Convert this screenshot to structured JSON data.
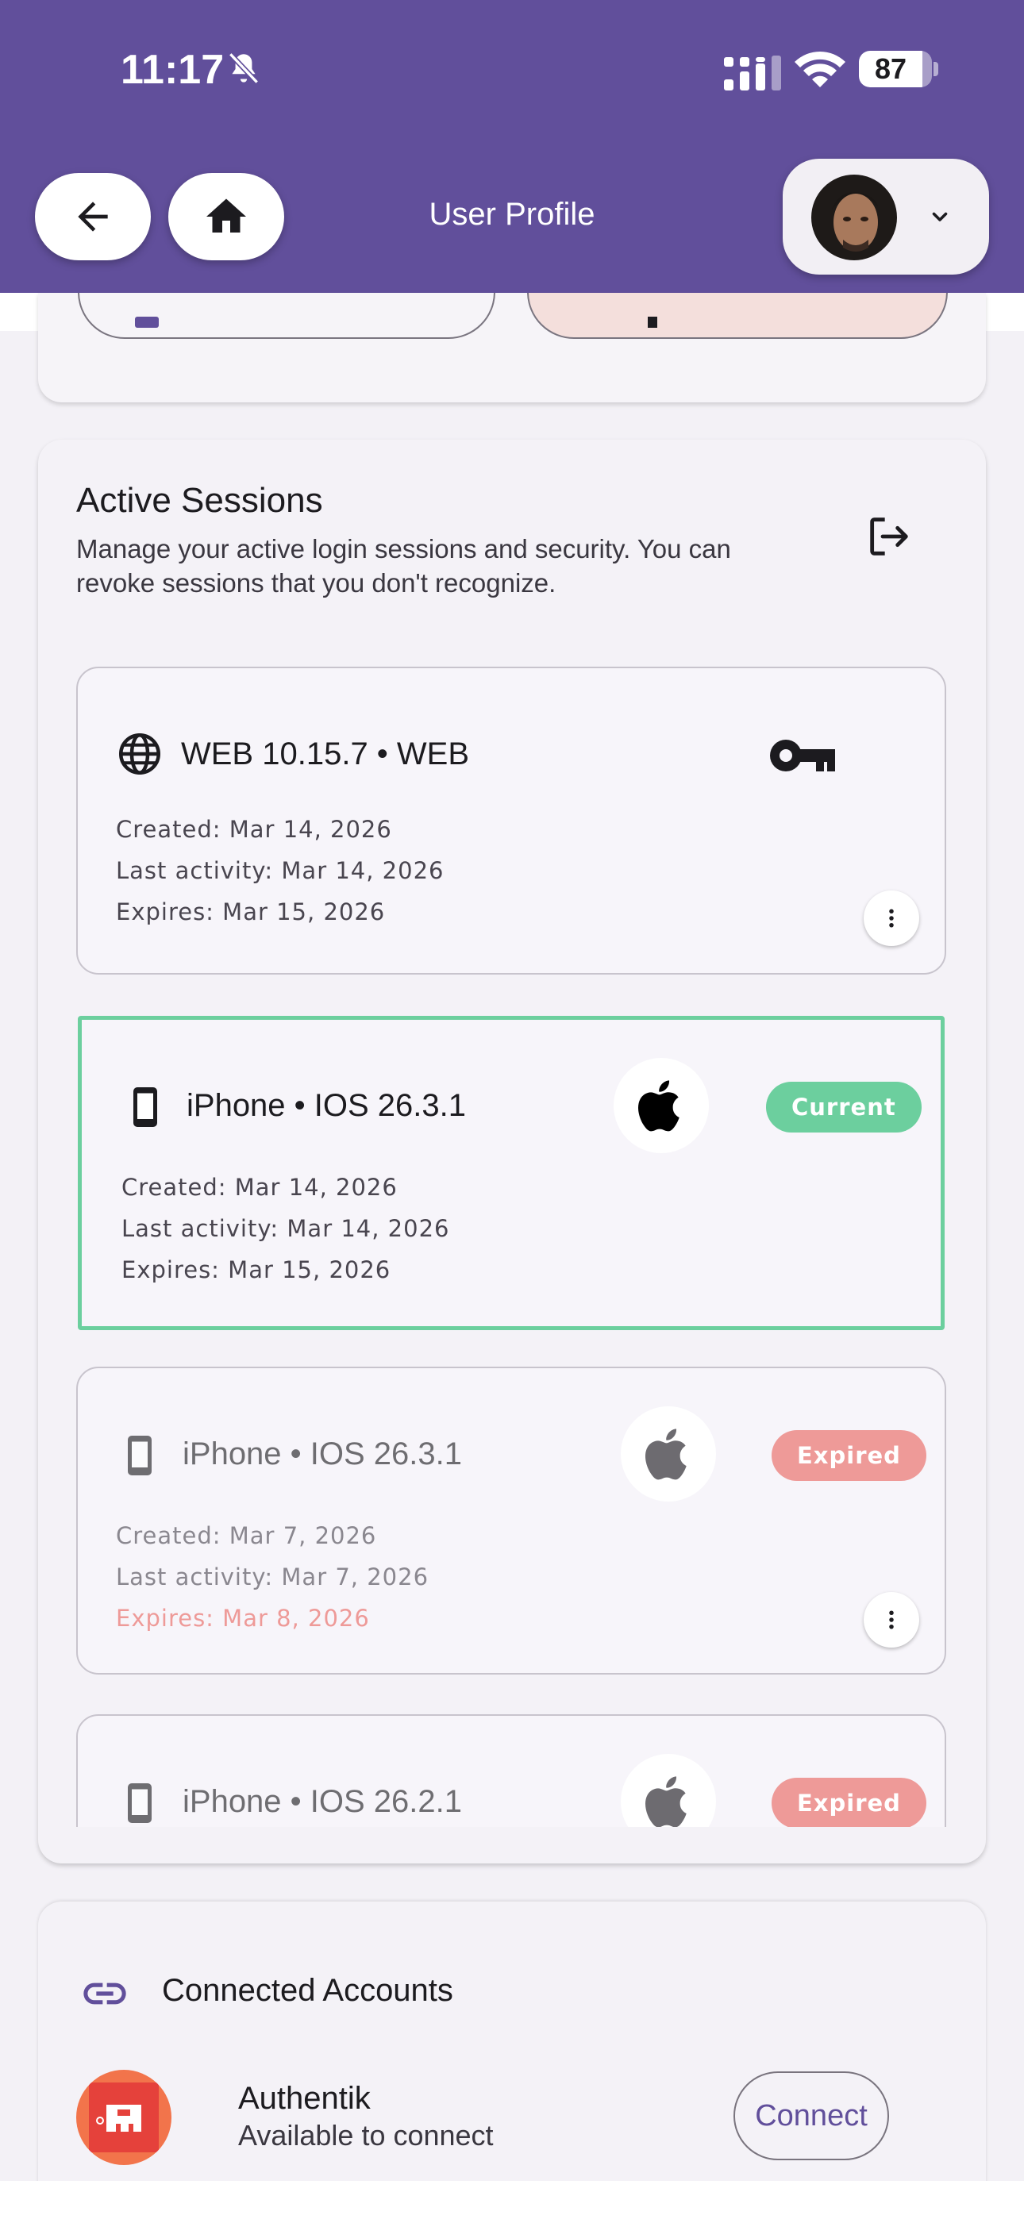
{
  "status_bar": {
    "time": "11:17",
    "battery": "87",
    "battery_level": 0.87
  },
  "header": {
    "title": "User Profile",
    "back_icon": "arrow-left-icon",
    "home_icon": "home-icon",
    "profile_chevron": "chevron-down-icon"
  },
  "colors": {
    "header": "#614f9b",
    "current_badge": "#6ccf9e",
    "expired_badge": "#ee9a98",
    "expired_text": "#ee9a98",
    "authentik": "#f2744b"
  },
  "sessions": {
    "title": "Active Sessions",
    "description": "Manage your active login sessions and security. You can revoke sessions that you don't recognize.",
    "items": [
      {
        "device": "WEB 10.15.7 • WEB",
        "created": "Created: Mar 14, 2026",
        "last_activity": "Last activity: Mar 14, 2026",
        "expires": "Expires: Mar 15, 2026"
      },
      {
        "device": "iPhone • IOS 26.3.1",
        "badge": "Current",
        "created": "Created: Mar 14, 2026",
        "last_activity": "Last activity: Mar 14, 2026",
        "expires": "Expires: Mar 15, 2026"
      },
      {
        "device": "iPhone • IOS 26.3.1",
        "badge": "Expired",
        "created": "Created: Mar 7, 2026",
        "last_activity": "Last activity: Mar 7, 2026",
        "expires": "Expires: Mar 8, 2026"
      },
      {
        "device": "iPhone • IOS 26.2.1",
        "badge": "Expired"
      }
    ]
  },
  "connected": {
    "title": "Connected Accounts",
    "provider": "Authentik",
    "status": "Available to connect",
    "connect_label": "Connect"
  }
}
